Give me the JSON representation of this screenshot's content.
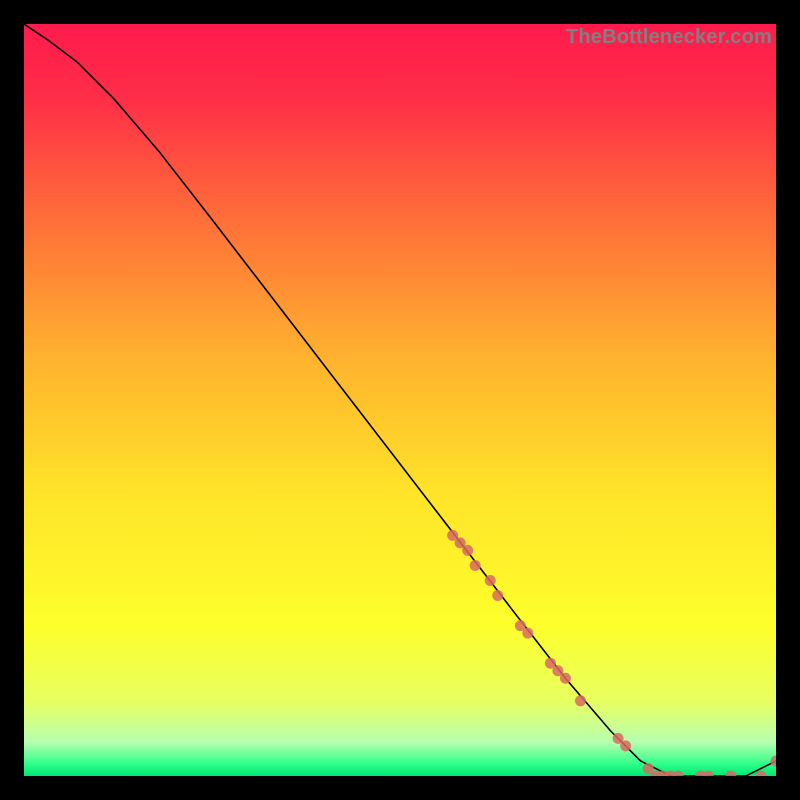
{
  "watermark": "TheBottlenecker.com",
  "chart_data": {
    "type": "line",
    "title": "",
    "xlabel": "",
    "ylabel": "",
    "xlim": [
      0,
      100
    ],
    "ylim": [
      0,
      100
    ],
    "grid": false,
    "background_gradient": {
      "stops": [
        {
          "offset": 0.0,
          "color": "#ff1a4d"
        },
        {
          "offset": 0.1,
          "color": "#ff2e47"
        },
        {
          "offset": 0.25,
          "color": "#ff6b3a"
        },
        {
          "offset": 0.45,
          "color": "#ffb42e"
        },
        {
          "offset": 0.62,
          "color": "#ffe329"
        },
        {
          "offset": 0.8,
          "color": "#fdff2b"
        },
        {
          "offset": 0.9,
          "color": "#e7ff60"
        },
        {
          "offset": 0.955,
          "color": "#b7ffb0"
        },
        {
          "offset": 0.985,
          "color": "#2bff87"
        },
        {
          "offset": 1.0,
          "color": "#00e676"
        }
      ]
    },
    "series": [
      {
        "name": "curve",
        "type": "line",
        "x": [
          0,
          3,
          7,
          12,
          18,
          25,
          35,
          45,
          55,
          65,
          72,
          78,
          82,
          86,
          88,
          92,
          96,
          100
        ],
        "y": [
          100,
          98,
          95,
          90,
          83,
          74,
          61,
          48,
          35,
          22,
          13,
          6,
          2,
          0,
          0,
          0,
          0,
          2
        ],
        "color": "#000000"
      },
      {
        "name": "markers",
        "type": "scatter",
        "x": [
          57,
          58,
          59,
          60,
          62,
          63,
          66,
          67,
          70,
          71,
          72,
          74,
          79,
          80,
          83,
          84,
          85,
          86,
          87,
          90,
          91,
          94,
          98,
          100
        ],
        "y": [
          32,
          31,
          30,
          28,
          26,
          24,
          20,
          19,
          15,
          14,
          13,
          10,
          5,
          4,
          1,
          0,
          0,
          0,
          0,
          0,
          0,
          0,
          0,
          2
        ],
        "color": "#d86a60"
      }
    ]
  }
}
